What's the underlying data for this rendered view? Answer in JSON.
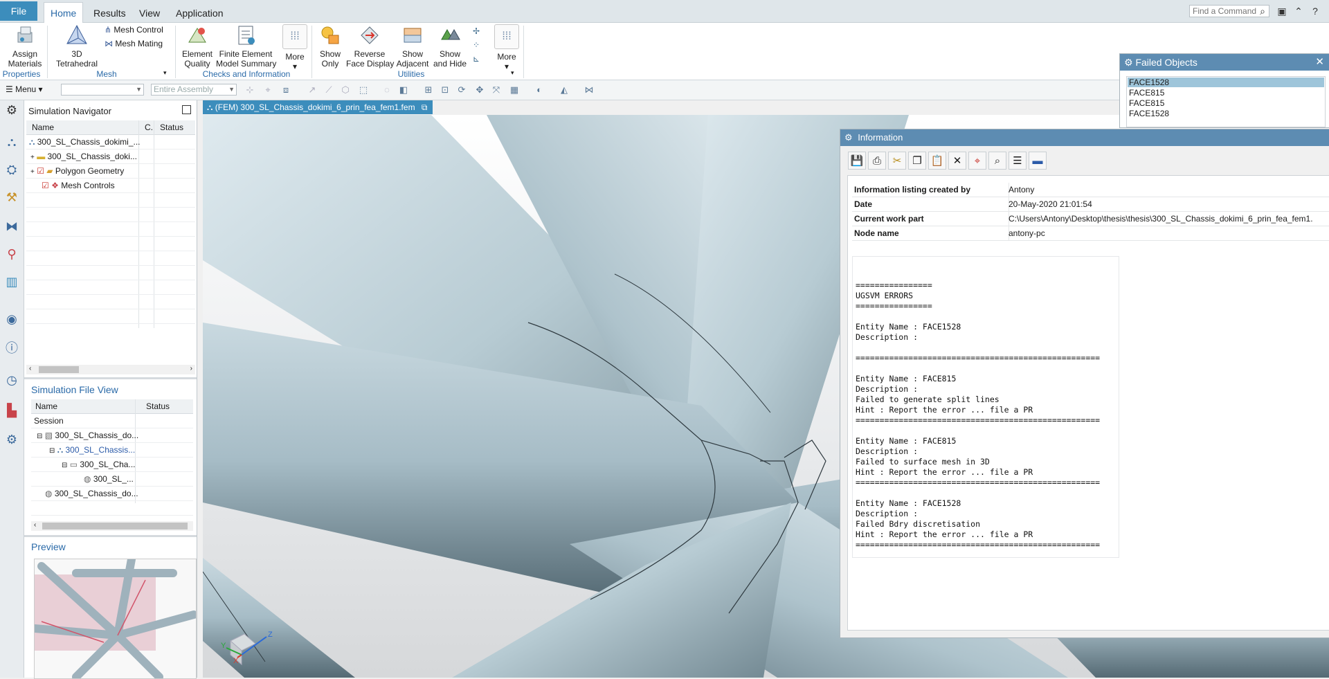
{
  "tabs": {
    "file": "File",
    "items": [
      "Home",
      "Results",
      "View",
      "Application"
    ],
    "active": "Home"
  },
  "find_command": {
    "placeholder": "Find a Command"
  },
  "ribbon": {
    "assign_materials": "Assign\nMaterials",
    "properties_group": "Properties",
    "tetrahedral": "3D\nTetrahedral",
    "mesh_control": "Mesh Control",
    "mesh_mating": "Mesh Mating",
    "mesh_group": "Mesh",
    "element_quality": "Element\nQuality",
    "fe_model_summary": "Finite Element\nModel Summary",
    "more": "More",
    "checks_group": "Checks and Information",
    "show_only": "Show\nOnly",
    "reverse_face_display": "Reverse\nFace Display",
    "show_adjacent": "Show\nAdjacent",
    "show_and_hide": "Show\nand Hide",
    "more2": "More",
    "utilities_group": "Utilities"
  },
  "selbar": {
    "menu": "Menu",
    "filter_value": "",
    "scope_placeholder": "Entire Assembly"
  },
  "navigator": {
    "title": "Simulation Navigator",
    "columns": [
      "Name",
      "C.",
      "Status"
    ],
    "rows": [
      "300_SL_Chassis_dokimi_...",
      "300_SL_Chassis_doki...",
      "Polygon Geometry",
      "Mesh Controls"
    ]
  },
  "file_view": {
    "title": "Simulation File View",
    "columns": [
      "Name",
      "Status"
    ],
    "rows": [
      "Session",
      "300_SL_Chassis_do...",
      "300_SL_Chassis...",
      "300_SL_Cha...",
      "300_SL_...",
      "300_SL_Chassis_do..."
    ]
  },
  "preview": {
    "title": "Preview"
  },
  "viewport": {
    "tab_label": "(FEM) 300_SL_Chassis_dokimi_6_prin_fea_fem1.fem"
  },
  "failed_objects": {
    "title": "Failed Objects",
    "items": [
      "FACE1528",
      "FACE815",
      "FACE815",
      "FACE1528"
    ],
    "selected_index": 0
  },
  "information": {
    "title": "Information",
    "meta": [
      {
        "key": "Information listing created by",
        "value": "Antony"
      },
      {
        "key": "Date",
        "value": "20-May-2020 21:01:54"
      },
      {
        "key": "Current work part",
        "value": "C:\\Users\\Antony\\Desktop\\thesis\\thesis\\300_SL_Chassis_dokimi_6_prin_fea_fem1."
      },
      {
        "key": "Node name",
        "value": "antony-pc"
      }
    ],
    "log": "\n\n================\nUGSVM ERRORS\n================\n\nEntity Name : FACE1528\nDescription :\n\n===================================================\n\nEntity Name : FACE815\nDescription :\nFailed to generate split lines\nHint : Report the error ... file a PR\n===================================================\n\nEntity Name : FACE815\nDescription :\nFailed to surface mesh in 3D\nHint : Report the error ... file a PR\n===================================================\n\nEntity Name : FACE1528\nDescription :\nFailed Bdry discretisation\nHint : Report the error ... file a PR\n==================================================="
  },
  "triad": {
    "x": "X",
    "y": "Y",
    "z": "Z"
  },
  "colors": {
    "accent": "#3c8dbc",
    "title_bar": "#5d8cb2",
    "tube": "#b7cbd3"
  }
}
